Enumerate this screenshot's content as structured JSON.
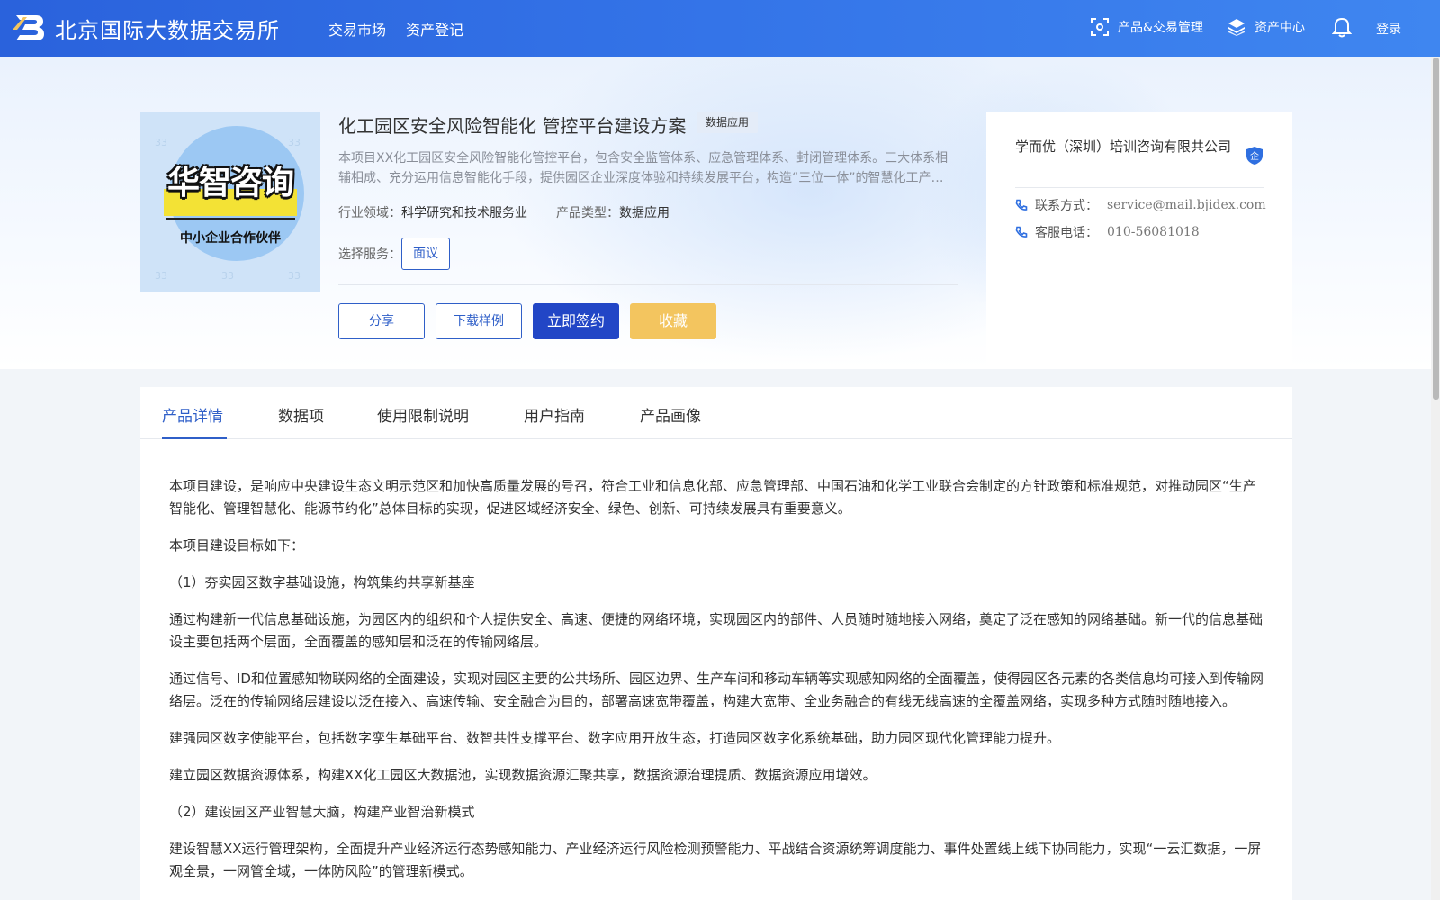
{
  "header": {
    "logo_text": "北京国际大数据交易所",
    "nav": {
      "market": "交易市场",
      "register": "资产登记"
    },
    "product_mgmt": "产品&交易管理",
    "asset_center": "资产中心",
    "login": "登录",
    "icons": [
      "scan-icon",
      "layers-icon",
      "bell-icon"
    ]
  },
  "product": {
    "cover": {
      "title": "华智咨询",
      "subtitle": "中小企业合作伙伴",
      "numbers": [
        "33",
        "33",
        "33",
        "33",
        "33"
      ]
    },
    "title": "化工园区安全风险智能化 管控平台建设方案",
    "tag": "数据应用",
    "description_line1": "本项目XX化工园区安全风险智能化管控平台，包含安全监管体系、应急管理体系、封闭管理体系。三大体系相",
    "description_line2": "辅相成、充分运用信息智能化手段，提供园区企业深度体验和持续发展平台，构造“三位一体”的智慧化工产业园区。",
    "industry_label": "行业领域：",
    "industry_value": "科学研究和技术服务业",
    "type_label": "产品类型：",
    "type_value": "数据应用",
    "service_label": "选择服务：",
    "service_option": "面议",
    "buttons": {
      "share": "分享",
      "download": "下载样例",
      "sign": "立即签约",
      "favorite": "收藏"
    }
  },
  "seller": {
    "name": "学而优（深圳）培训咨询有限共公司",
    "badge": "企",
    "contact_label": "联系方式：",
    "contact_value": "service@mail.bjidex.com",
    "phone_label": "客服电话：",
    "phone_value": "010-56081018"
  },
  "tabs": [
    "产品详情",
    "数据项",
    "使用限制说明",
    "用户指南",
    "产品画像"
  ],
  "article": [
    "本项目建设，是响应中央建设生态文明示范区和加快高质量发展的号召，符合工业和信息化部、应急管理部、中国石油和化学工业联合会制定的方针政策和标准规范，对推动园区“生产智能化、管理智慧化、能源节约化”总体目标的实现，促进区域经济安全、绿色、创新、可持续发展具有重要意义。",
    "本项目建设目标如下：",
    "（1）夯实园区数字基础设施，构筑集约共享新基座",
    "通过构建新一代信息基础设施，为园区内的组织和个人提供安全、高速、便捷的网络环境，实现园区内的部件、人员随时随地接入网络，奠定了泛在感知的网络基础。新一代的信息基础设主要包括两个层面，全面覆盖的感知层和泛在的传输网络层。",
    "通过信号、ID和位置感知物联网络的全面建设，实现对园区主要的公共场所、园区边界、生产车间和移动车辆等实现感知网络的全面覆盖，使得园区各元素的各类信息均可接入到传输网络层。泛在的传输网络层建设以泛在接入、高速传输、安全融合为目的，部署高速宽带覆盖，构建大宽带、全业务融合的有线无线高速的全覆盖网络，实现多种方式随时随地接入。",
    "建强园区数字使能平台，包括数字孪生基础平台、数智共性支撑平台、数字应用开放生态，打造园区数字化系统基础，助力园区现代化管理能力提升。",
    "建立园区数据资源体系，构建XX化工园区大数据池，实现数据资源汇聚共享，数据资源治理提质、数据资源应用增效。",
    "（2）建设园区产业智慧大脑，构建产业智治新模式",
    "建设智慧XX运行管理架构，全面提升产业经济运行态势感知能力、产业经济运行风险检测预警能力、平战结合资源统筹调度能力、事件处置线上线下协同能力，实现“一云汇数据，一屏观全景，一网管全域，一体防风险”的管理新模式。"
  ],
  "colors": {
    "header_start": "#2a62dc",
    "header_end": "#3f86f0",
    "accent": "#2f5fc8",
    "sign_button": "#2246c6",
    "favorite_button": "#f3c55f"
  }
}
